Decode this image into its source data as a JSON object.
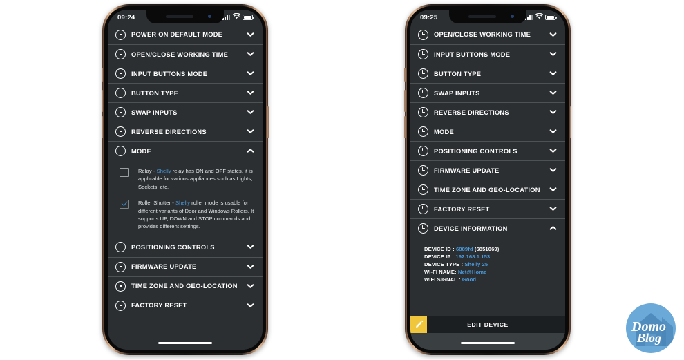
{
  "page": {
    "background": "#ffffff",
    "accent_blue": "#4a9ade",
    "screen_bg": "#2b2f32",
    "divider": "#4d5255",
    "yellow": "#f0c73c"
  },
  "phone_left": {
    "status": {
      "time": "09:24",
      "signal_icon": "signal-bars-icon",
      "wifi_icon": "wifi-icon",
      "battery_icon": "battery-icon"
    },
    "rows_top": [
      {
        "label": "POWER ON DEFAULT MODE",
        "icon": "clock-icon",
        "chevron": "chevron-down-icon"
      },
      {
        "label": "OPEN/CLOSE WORKING TIME",
        "icon": "clock-icon",
        "chevron": "chevron-down-icon"
      },
      {
        "label": "INPUT BUTTONS MODE",
        "icon": "clock-icon",
        "chevron": "chevron-down-icon"
      },
      {
        "label": "BUTTON TYPE",
        "icon": "clock-icon",
        "chevron": "chevron-down-icon"
      },
      {
        "label": "SWAP INPUTS",
        "icon": "clock-icon",
        "chevron": "chevron-down-icon"
      },
      {
        "label": "REVERSE DIRECTIONS",
        "icon": "clock-icon",
        "chevron": "chevron-down-icon"
      }
    ],
    "expanded": {
      "label": "MODE",
      "icon": "clock-icon",
      "chevron": "chevron-up-icon",
      "options": [
        {
          "checked": false,
          "prefix": "Relay - ",
          "brand": "Shelly",
          "suffix": " relay has ON and OFF states, it is applicable for various appliances such as Lights, Sockets, etc."
        },
        {
          "checked": true,
          "prefix": "Roller Shutter - ",
          "brand": "Shelly",
          "suffix": " roller mode is usable for different variants of Door and Windows Rollers. It supports UP, DOWN and STOP commands and provides different settings."
        }
      ]
    },
    "rows_bottom": [
      {
        "label": "POSITIONING CONTROLS",
        "icon": "clock-icon",
        "chevron": "chevron-down-icon"
      },
      {
        "label": "FIRMWARE UPDATE",
        "icon": "clock-icon",
        "chevron": "chevron-down-icon"
      },
      {
        "label": "TIME ZONE AND GEO-LOCATION",
        "icon": "clock-icon",
        "chevron": "chevron-down-icon"
      },
      {
        "label": "FACTORY RESET",
        "icon": "clock-icon",
        "chevron": "chevron-down-icon"
      }
    ]
  },
  "phone_right": {
    "status": {
      "time": "09:25",
      "signal_icon": "signal-bars-icon",
      "wifi_icon": "wifi-icon",
      "battery_icon": "battery-icon"
    },
    "rows": [
      {
        "label": "OPEN/CLOSE WORKING TIME",
        "icon": "clock-icon",
        "chevron": "chevron-down-icon"
      },
      {
        "label": "INPUT BUTTONS MODE",
        "icon": "clock-icon",
        "chevron": "chevron-down-icon"
      },
      {
        "label": "BUTTON TYPE",
        "icon": "clock-icon",
        "chevron": "chevron-down-icon"
      },
      {
        "label": "SWAP INPUTS",
        "icon": "clock-icon",
        "chevron": "chevron-down-icon"
      },
      {
        "label": "REVERSE DIRECTIONS",
        "icon": "clock-icon",
        "chevron": "chevron-down-icon"
      },
      {
        "label": "MODE",
        "icon": "clock-icon",
        "chevron": "chevron-down-icon"
      },
      {
        "label": "POSITIONING CONTROLS",
        "icon": "clock-icon",
        "chevron": "chevron-down-icon"
      },
      {
        "label": "FIRMWARE UPDATE",
        "icon": "clock-icon",
        "chevron": "chevron-down-icon"
      },
      {
        "label": "TIME ZONE AND GEO-LOCATION",
        "icon": "clock-icon",
        "chevron": "chevron-down-icon"
      },
      {
        "label": "FACTORY RESET",
        "icon": "clock-icon",
        "chevron": "chevron-down-icon"
      }
    ],
    "device_information": {
      "label": "DEVICE INFORMATION",
      "icon": "clock-icon",
      "chevron": "chevron-up-icon",
      "fields": [
        {
          "key": "DEVICE ID : ",
          "value": "6889fd",
          "extra": " (6851069)"
        },
        {
          "key": "DEVICE IP : ",
          "value": "192.168.1.153",
          "extra": ""
        },
        {
          "key": "DEVICE TYPE : ",
          "value": "Shelly 25",
          "extra": ""
        },
        {
          "key": "WI-FI NAME: ",
          "value": "Net@Home",
          "extra": ""
        },
        {
          "key": "WIFI SIGNAL : ",
          "value": "Good",
          "extra": ""
        }
      ]
    },
    "edit_bar": {
      "label": "EDIT DEVICE",
      "icon": "pencil-icon"
    }
  },
  "watermark": {
    "line1": "Domo",
    "line2": "Blog",
    "icon": "domoblog-house-logo"
  }
}
